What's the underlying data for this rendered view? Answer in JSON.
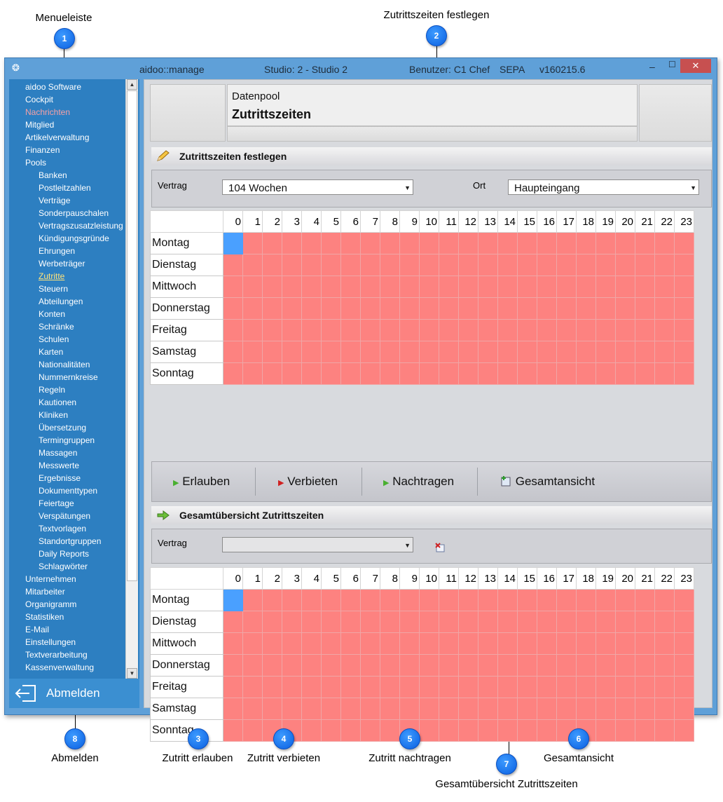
{
  "callouts": {
    "c1": {
      "num": "1",
      "label": "Menueleiste"
    },
    "c2": {
      "num": "2",
      "label": "Zutrittszeiten festlegen"
    },
    "c3": {
      "num": "3",
      "label": "Zutritt erlauben"
    },
    "c4": {
      "num": "4",
      "label": "Zutritt verbieten"
    },
    "c5": {
      "num": "5",
      "label": "Zutritt nachtragen"
    },
    "c6": {
      "num": "6",
      "label": "Gesamtansicht"
    },
    "c7": {
      "num": "7",
      "label": "Gesamtübersicht Zutrittszeiten"
    },
    "c8": {
      "num": "8",
      "label": "Abmelden"
    }
  },
  "window": {
    "app": "aidoo::manage",
    "studio": "Studio: 2 - Studio 2",
    "user": "Benutzer: C1 Chef",
    "mode": "SEPA",
    "version": "v160215.6",
    "minimize": "–",
    "maximize": "☐",
    "close": "✕"
  },
  "sidebar": {
    "items": [
      "aidoo Software",
      "Cockpit",
      "Nachrichten",
      "Mitglied",
      "Artikelverwaltung",
      "Finanzen",
      "Pools"
    ],
    "pool_items": [
      "Banken",
      "Postleitzahlen",
      "Verträge",
      "Sonderpauschalen",
      "Vertragszusatzleistung",
      "Kündigungsgründe",
      "Ehrungen",
      "Werbeträger",
      "Zutritte",
      "Steuern",
      "Abteilungen",
      "Konten",
      "Schränke",
      "Schulen",
      "Karten",
      "Nationalitäten",
      "Nummernkreise",
      "Regeln",
      "Kautionen",
      "Kliniken",
      "Übersetzung",
      "Termingruppen",
      "Massagen",
      "Messwerte",
      "Ergebnisse",
      "Dokumenttypen",
      "Feiertage",
      "Verspätungen",
      "Textvorlagen",
      "Standortgruppen",
      "Daily Reports",
      "Schlagwörter"
    ],
    "bottom_items": [
      "Unternehmen",
      "Mitarbeiter",
      "Organigramm",
      "Statistiken",
      "E-Mail",
      "Einstellungen",
      "Textverarbeitung",
      "Kassenverwaltung"
    ],
    "active_item": "Zutritte",
    "highlight_item": "Nachrichten",
    "logout_label": "Abmelden"
  },
  "header": {
    "subtitle": "Datenpool",
    "title": "Zutrittszeiten"
  },
  "section1": {
    "title": "Zutrittszeiten festlegen",
    "vertrag_label": "Vertrag",
    "vertrag_value": "104 Wochen",
    "ort_label": "Ort",
    "ort_value": "Haupteingang"
  },
  "hours": [
    "0",
    "1",
    "2",
    "3",
    "4",
    "5",
    "6",
    "7",
    "8",
    "9",
    "10",
    "11",
    "12",
    "13",
    "14",
    "15",
    "16",
    "17",
    "18",
    "19",
    "20",
    "21",
    "22",
    "23"
  ],
  "days": [
    "Montag",
    "Dienstag",
    "Mittwoch",
    "Donnerstag",
    "Freitag",
    "Samstag",
    "Sonntag"
  ],
  "grid1_allowed": [
    [
      0,
      0
    ]
  ],
  "buttons": {
    "allow": "Erlauben",
    "deny": "Verbieten",
    "add": "Nachtragen",
    "overview": "Gesamtansicht"
  },
  "section2": {
    "title": "Gesamtübersicht Zutrittszeiten",
    "vertrag_label": "Vertrag",
    "vertrag_value": ""
  },
  "grid2_allowed": [
    [
      0,
      0
    ]
  ],
  "colors": {
    "allowed": "#4aa0ff",
    "denied": "#fd8280",
    "sidebar": "#2d7fc1",
    "accent": "#0a5fe0"
  }
}
